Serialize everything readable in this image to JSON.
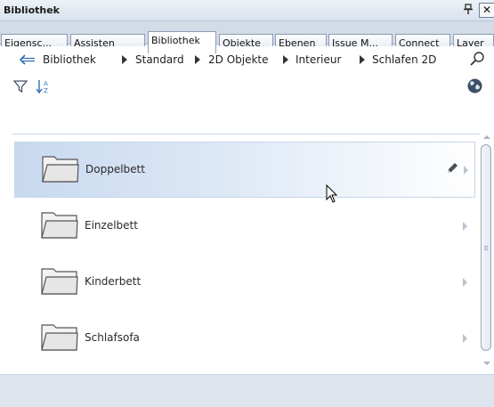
{
  "window": {
    "title": "Bibliothek",
    "pin_glyph": "ᴪ",
    "close_glyph": "✕"
  },
  "tabs": [
    {
      "label": "Eigensc..."
    },
    {
      "label": "Assisten"
    },
    {
      "label": "Bibliothek",
      "active": true
    },
    {
      "label": "Objekte"
    },
    {
      "label": "Ebenen"
    },
    {
      "label": "Issue M..."
    },
    {
      "label": "Connect"
    },
    {
      "label": "Layer"
    }
  ],
  "breadcrumb": {
    "back_icon": "back-arrow-icon",
    "items": [
      "Bibliothek",
      "Standard",
      "2D Objekte",
      "Interieur",
      "Schlafen 2D"
    ],
    "search_icon": "search-icon"
  },
  "toolbar": {
    "filter_icon": "filter-icon",
    "sort_icon": "sort-az-icon",
    "globe_icon": "globe-icon"
  },
  "folders": [
    {
      "label": "Doppelbett",
      "selected": true,
      "edit_icon": "pencil-icon"
    },
    {
      "label": "Einzelbett"
    },
    {
      "label": "Kinderbett"
    },
    {
      "label": "Schlafsofa"
    }
  ],
  "colors": {
    "selection": "#c8d9ef",
    "accent": "#2e6db5",
    "tab_border": "#8c9db5"
  }
}
